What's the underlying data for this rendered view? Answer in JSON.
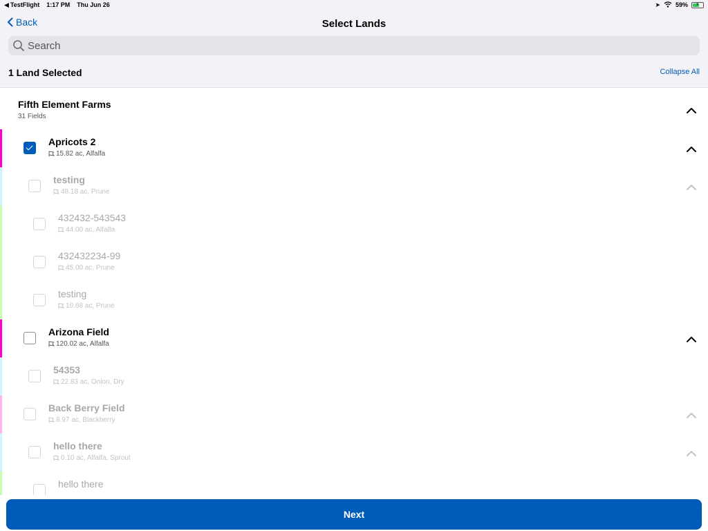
{
  "status_bar": {
    "app": "TestFlight",
    "time": "1:17 PM",
    "date": "Thu Jun 26",
    "battery": "59%"
  },
  "nav": {
    "back_label": "Back",
    "title": "Select Lands"
  },
  "search": {
    "placeholder": "Search"
  },
  "selection": {
    "count_label": "1 Land Selected",
    "collapse_all_label": "Collapse All"
  },
  "group": {
    "title": "Fifth Element Farms",
    "subtitle": "31 Fields"
  },
  "rows": [
    {
      "title": "Apricots 2",
      "subtitle": "15.82 ac, Alfalfa",
      "checked": true,
      "dim": false,
      "bar_color": "#ff00cc",
      "has_chevron": true
    },
    {
      "title": "testing",
      "subtitle": "48.18 ac, Prune",
      "checked": false,
      "dim": true,
      "bar_color": "#ccf7ff",
      "has_chevron": true
    },
    {
      "title": "432432-543543",
      "subtitle": "44.00 ac, Alfalfa",
      "checked": false,
      "dim": true,
      "bar_color": "#c7ffb0",
      "has_chevron": false
    },
    {
      "title": "432432234-99",
      "subtitle": "45.00 ac, Prune",
      "checked": false,
      "dim": true,
      "bar_color": "#c7ffb0",
      "has_chevron": false
    },
    {
      "title": "testing",
      "subtitle": "10.68 ac, Prune",
      "checked": false,
      "dim": true,
      "bar_color": "#c7ffb0",
      "has_chevron": false
    },
    {
      "title": "Arizona Field",
      "subtitle": "120.02 ac, Alfalfa",
      "checked": false,
      "dim": false,
      "bar_color": "#ff00cc",
      "has_chevron": true
    },
    {
      "title": "54353",
      "subtitle": "22.83 ac, Onion, Dry",
      "checked": false,
      "dim": true,
      "bar_color": "#ccf7ff",
      "has_chevron": false
    },
    {
      "title": "Back Berry Field",
      "subtitle": "8.97 ac, Blackberry",
      "checked": false,
      "dim": true,
      "bar_color": "#ffb3f0",
      "has_chevron": true
    },
    {
      "title": "hello there",
      "subtitle": "0.10 ac, Alfalfa, Sprout",
      "checked": false,
      "dim": true,
      "bar_color": "#ccf7ff",
      "has_chevron": true
    },
    {
      "title": "hello there",
      "subtitle": "",
      "checked": false,
      "dim": true,
      "bar_color": "#c7ffb0",
      "has_chevron": false
    }
  ],
  "footer": {
    "next_label": "Next"
  },
  "colors": {
    "accent": "#005cb9"
  }
}
